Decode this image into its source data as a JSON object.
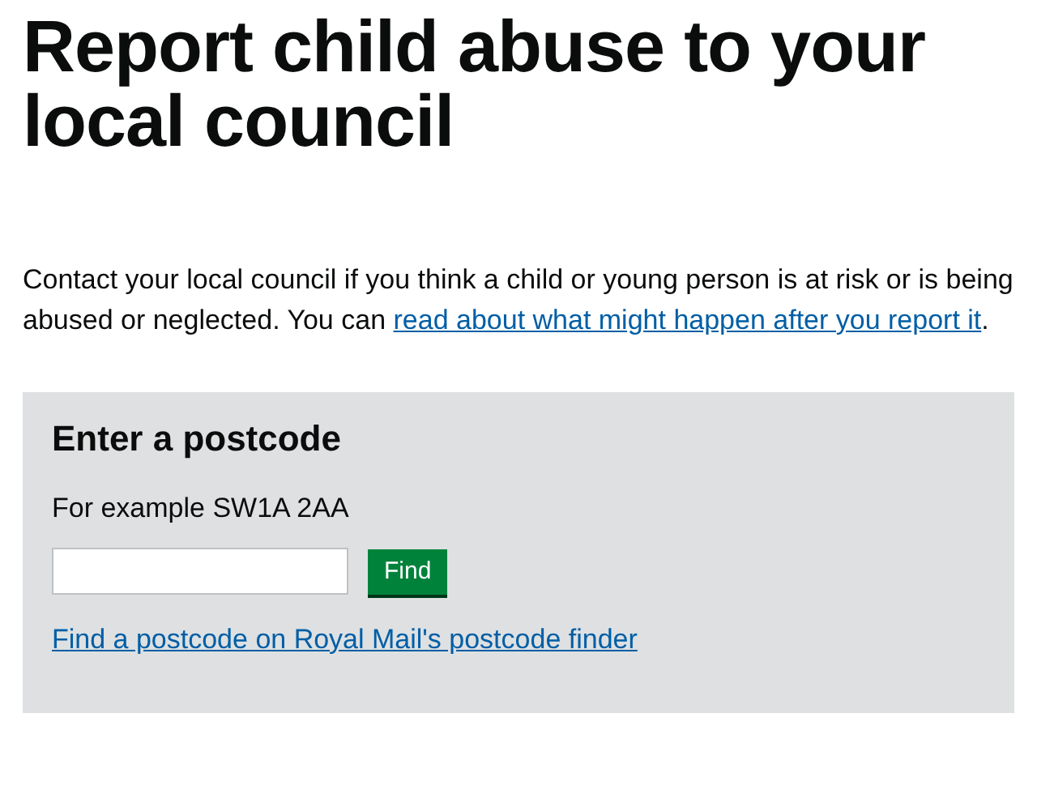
{
  "heading": "Report child abuse to your local council",
  "intro": {
    "text": "Contact your local council if you think a child or young person is at risk or is being abused or neglected. You can ",
    "link": "read about what might happen after you report it",
    "end": "."
  },
  "postcode_box": {
    "title": "Enter a postcode",
    "hint": "For example SW1A 2AA",
    "button": "Find",
    "link": "Find a postcode on Royal Mail's postcode finder"
  }
}
